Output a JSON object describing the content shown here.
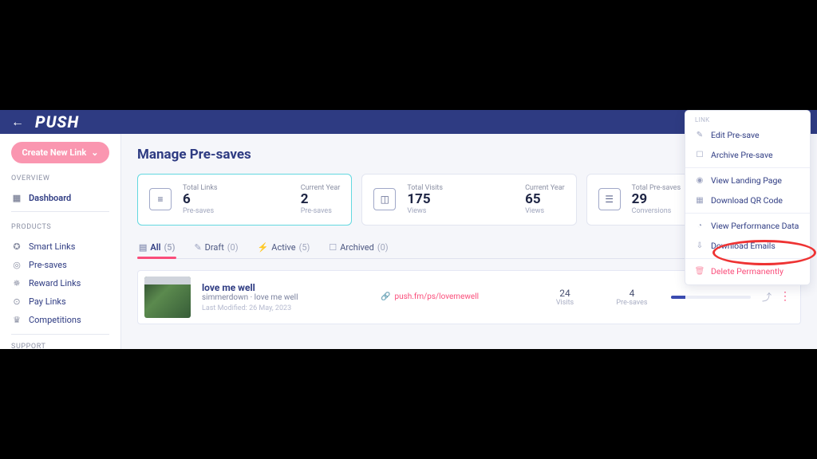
{
  "header": {
    "logo": "PUSH",
    "menu_header": "LINK"
  },
  "sidebar": {
    "create_label": "Create New Link",
    "sections": {
      "overview": "OVERVIEW",
      "products": "PRODUCTS",
      "support": "SUPPORT"
    },
    "items": {
      "dashboard": "Dashboard",
      "smart_links": "Smart Links",
      "pre_saves": "Pre-saves",
      "reward_links": "Reward Links",
      "pay_links": "Pay Links",
      "competitions": "Competitions"
    }
  },
  "page": {
    "title": "Manage Pre-saves"
  },
  "cards": [
    {
      "active": true,
      "left": {
        "label": "Total Links",
        "value": "6",
        "sub": "Pre-saves"
      },
      "right": {
        "label": "Current Year",
        "value": "2",
        "sub": "Pre-saves"
      }
    },
    {
      "active": false,
      "left": {
        "label": "Total Visits",
        "value": "175",
        "sub": "Views"
      },
      "right": {
        "label": "Current Year",
        "value": "65",
        "sub": "Views"
      }
    },
    {
      "active": false,
      "left": {
        "label": "Total Pre-saves",
        "value": "29",
        "sub": "Conversions"
      },
      "right": {
        "label": "",
        "value": "",
        "sub": ""
      }
    }
  ],
  "tabs": [
    {
      "icon": "stack",
      "label": "All",
      "count": "(5)",
      "current": true
    },
    {
      "icon": "draft",
      "label": "Draft",
      "count": "(0)",
      "current": false
    },
    {
      "icon": "bolt",
      "label": "Active",
      "count": "(5)",
      "current": false
    },
    {
      "icon": "archive",
      "label": "Archived",
      "count": "(0)",
      "current": false
    }
  ],
  "rows": [
    {
      "title": "love me well",
      "subtitle": "simmerdown · love me well",
      "modified": "Last Modified: 26 May, 2023",
      "link": "push.fm/ps/lovemewell",
      "visits": "24",
      "visits_label": "Visits",
      "presaves": "4",
      "presaves_label": "Pre-saves"
    }
  ],
  "menu": {
    "edit": "Edit Pre-save",
    "archive": "Archive Pre-save",
    "view_landing": "View Landing Page",
    "download_qr": "Download QR Code",
    "view_perf": "View Performance Data",
    "download_emails": "Download Emails",
    "delete": "Delete Permanently"
  }
}
